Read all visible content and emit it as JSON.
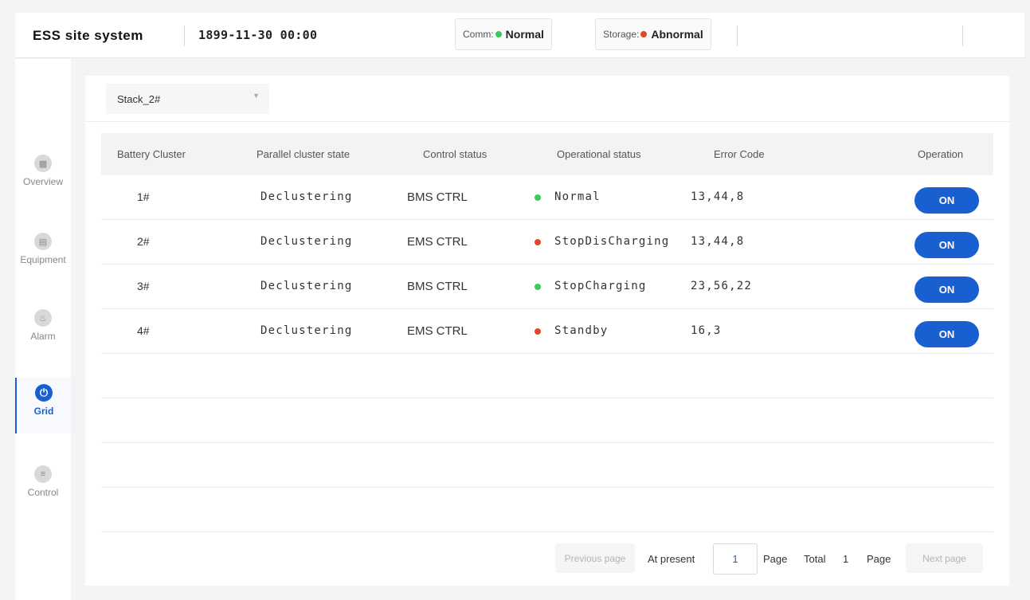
{
  "header": {
    "brand": "ESS site system",
    "datetime": "1899-11-30 00:00",
    "comm_label": "Comm:",
    "comm_value": "Normal",
    "comm_color": "#3cc85a",
    "storage_label": "Storage:",
    "storage_value": "Abnormal",
    "storage_color": "#e2462b"
  },
  "sidebar": {
    "items": [
      {
        "label": "Overview",
        "icon": "bar-chart-icon",
        "active": false
      },
      {
        "label": "Equipment",
        "icon": "server-icon",
        "active": false
      },
      {
        "label": "Alarm",
        "icon": "alarm-icon",
        "active": false
      },
      {
        "label": "Grid",
        "icon": "power-icon",
        "active": true
      },
      {
        "label": "Control",
        "icon": "sliders-icon",
        "active": false
      }
    ]
  },
  "stack_select": {
    "value": "Stack_2#"
  },
  "table": {
    "headers": {
      "cluster": "Battery Cluster",
      "parallel": "Parallel cluster state",
      "control": "Control status",
      "operational": "Operational status",
      "error": "Error Code",
      "operation": "Operation"
    },
    "rows": [
      {
        "cluster": "1#",
        "parallel": "Declustering",
        "control": "BMS CTRL",
        "operational": "Normal",
        "status_color": "#3cc85a",
        "error": "13,44,8",
        "button": "ON"
      },
      {
        "cluster": "2#",
        "parallel": "Declustering",
        "control": "EMS CTRL",
        "operational": "StopDisCharging",
        "status_color": "#e2462b",
        "error": "13,44,8",
        "button": "ON"
      },
      {
        "cluster": "3#",
        "parallel": "Declustering",
        "control": "BMS CTRL",
        "operational": "StopCharging",
        "status_color": "#3cc85a",
        "error": "23,56,22",
        "button": "ON"
      },
      {
        "cluster": "4#",
        "parallel": "Declustering",
        "control": "EMS CTRL",
        "operational": "Standby",
        "status_color": "#e2462b",
        "error": "16,3",
        "button": "ON"
      }
    ]
  },
  "pagination": {
    "prev_label": "Previous page",
    "at_present_label": "At present",
    "current_page": "1",
    "page_label": "Page",
    "total_label": "Total",
    "total_pages": "1",
    "page_label_2": "Page",
    "next_label": "Next page"
  },
  "colors": {
    "accent": "#1a5fd0",
    "ok": "#3cc85a",
    "error": "#e2462b"
  }
}
